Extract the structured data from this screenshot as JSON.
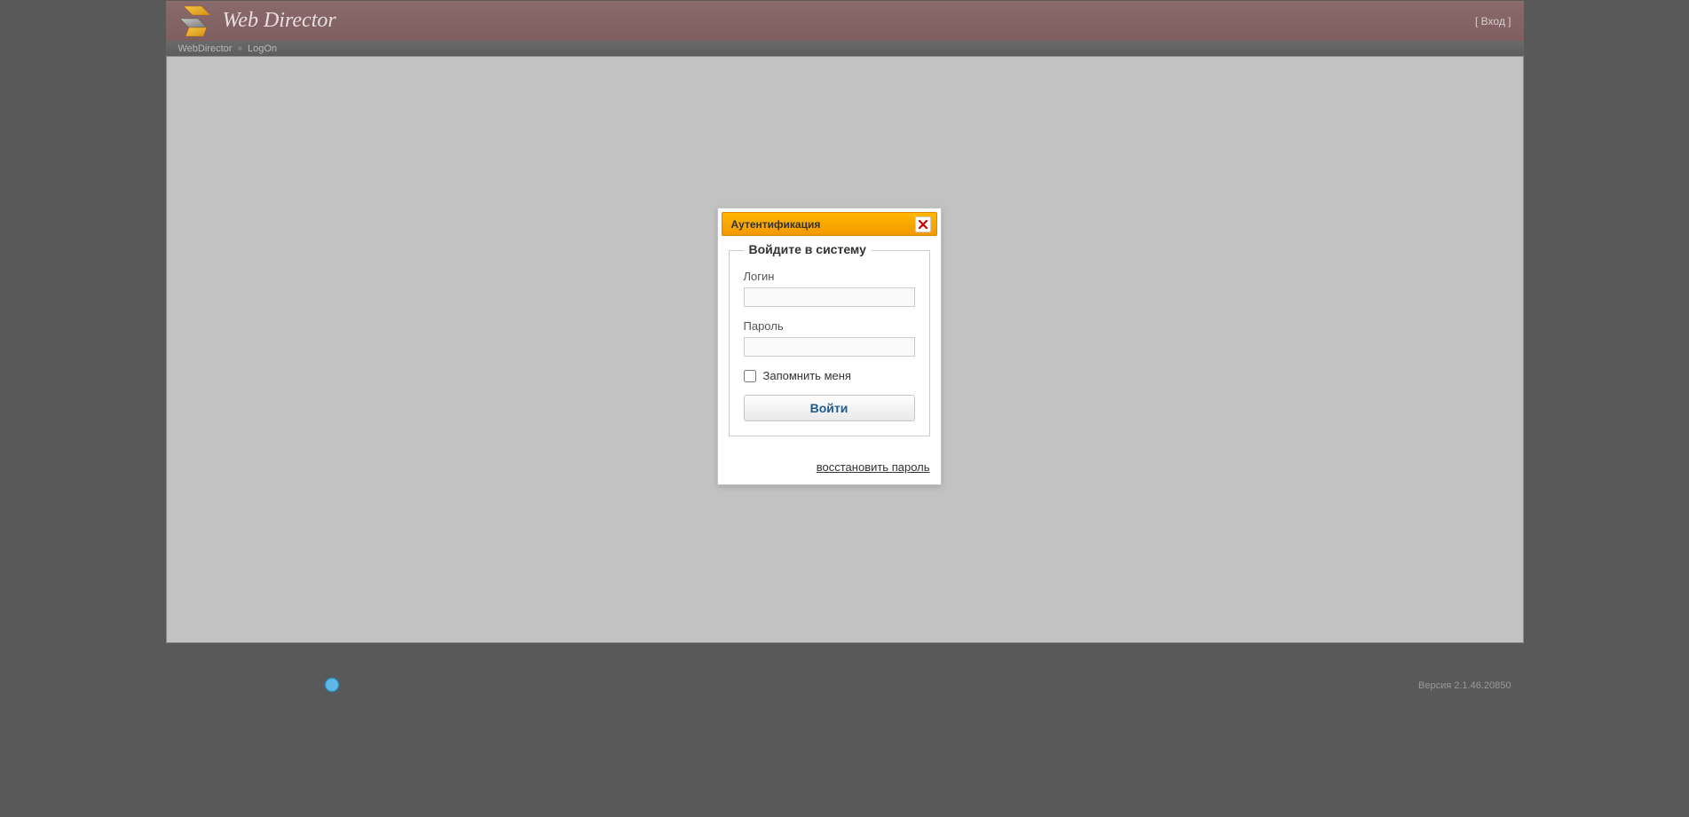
{
  "header": {
    "app_title": "Web Director",
    "login_link": "[ Вход ]"
  },
  "breadcrumb": {
    "items": [
      "WebDirector",
      "LogOn"
    ]
  },
  "dialog": {
    "title": "Аутентификация",
    "legend": "Войдите в систему",
    "login_label": "Логин",
    "login_value": "",
    "password_label": "Пароль",
    "password_value": "",
    "remember_label": "Запомнить меня",
    "submit_label": "Войти",
    "recover_link": "восстановить пароль"
  },
  "footer": {
    "version": "Версия 2.1.46.20850"
  }
}
